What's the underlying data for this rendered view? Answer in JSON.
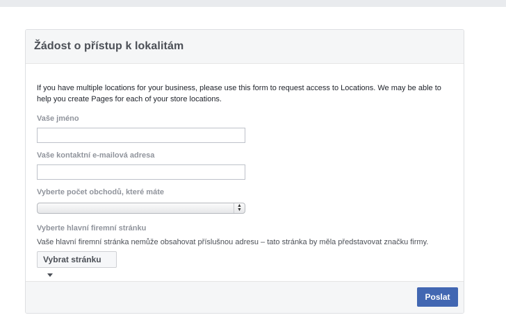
{
  "form": {
    "title": "Žádost o přístup k lokalitám",
    "intro": "If you have multiple locations for your business, please use this form to request access to Locations. We may be able to help you create Pages for each of your store locations.",
    "name_label": "Vaše jméno",
    "name_value": "",
    "email_label": "Vaše kontaktní e-mailová adresa",
    "email_value": "",
    "stores_label": "Vyberte počet obchodů, které máte",
    "stores_value": "",
    "page_label": "Vyberte hlavní firemní stránku",
    "page_help": "Vaše hlavní firemní stránka nemůže obsahovat příslušnou adresu – tato stránka by měla představovat značku firmy.",
    "page_button": "Vybrat stránku",
    "submit": "Poslat"
  },
  "colors": {
    "accent": "#4267b2",
    "label": "#90949c",
    "header_bg": "#f5f6f7"
  }
}
